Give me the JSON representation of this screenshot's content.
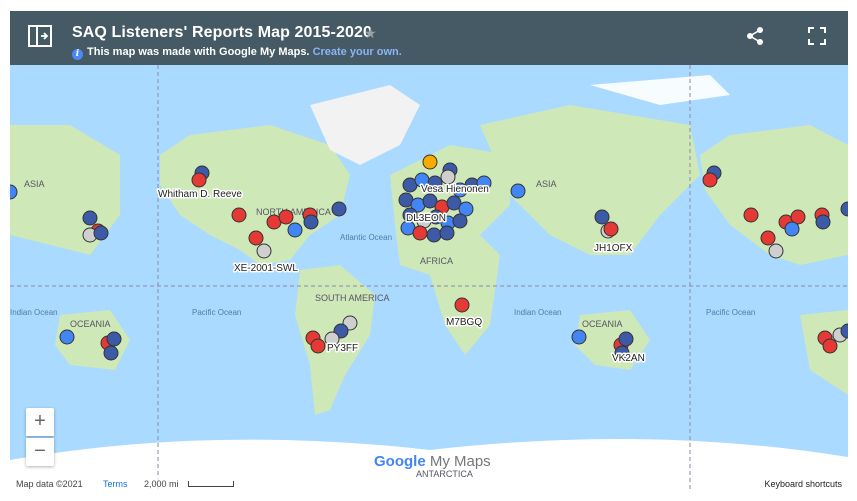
{
  "header": {
    "title": "SAQ Listeners' Reports Map 2015-2020",
    "info_text": "This map was made with Google My Maps.",
    "create_link": "Create your own.",
    "colors": {
      "bar": "#455a64",
      "link": "#8ab4f8"
    }
  },
  "controls": {
    "panel_icon": "side-panel-icon",
    "share_icon": "share-icon",
    "fullscreen_icon": "fullscreen-icon",
    "star_icon": "star-icon",
    "zoom_in": "+",
    "zoom_out": "−"
  },
  "footer": {
    "map_data": "Map data ©2021",
    "terms": "Terms",
    "scale": "2,000 mi",
    "keyboard": "Keyboard shortcuts",
    "brand_google": "Google",
    "brand_mymaps": "My Maps"
  },
  "map_labels": {
    "continents": [
      "ASIA",
      "NORTH AMERICA",
      "SOUTH AMERICA",
      "AFRICA",
      "ASIA",
      "OCEANIA",
      "OCEANIA",
      "ANTARCTICA"
    ],
    "oceans": [
      "Atlantic Ocean",
      "Pacific Ocean",
      "Indian Ocean",
      "Indian Ocean",
      "Pacific Ocean"
    ]
  },
  "callsigns": [
    "Whitham D. Reeve",
    "Vesa Hienonen",
    "DL3EON",
    "XE-2001-SWL",
    "JH1OFX",
    "M7BGQ",
    "PY3FF",
    "VK2AN"
  ],
  "marker_colors": {
    "red": "#e53935",
    "blue": "#4285f4",
    "navy": "#3c5aa6",
    "gray": "#cfcfcf",
    "yellow": "#f9ab00"
  }
}
